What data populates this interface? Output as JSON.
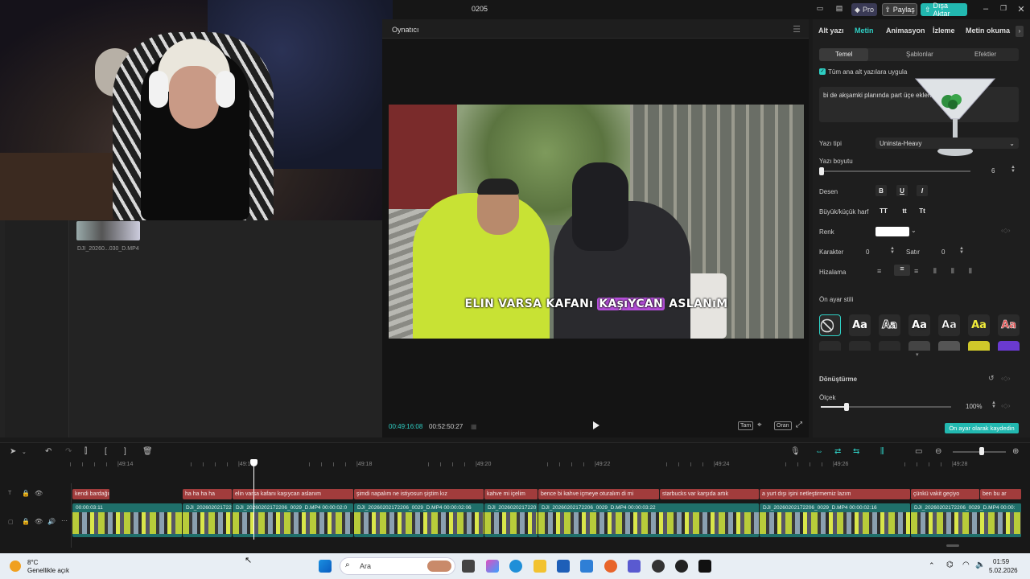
{
  "window": {
    "title": "0205",
    "pro_label": "Pro",
    "share_label": "Paylaş",
    "export_label": "Dışa Aktar"
  },
  "media": {
    "thumb_label": "DJI_20260...030_D.MP4"
  },
  "player": {
    "title": "Oynatıcı",
    "current_time": "00:49:16:08",
    "total_time": "00:52:50:27",
    "btn_full": "Tam",
    "btn_ratio": "Oran",
    "subtitle_pre": "ELIN VARSA KAFANı",
    "subtitle_hl": "KAşıYCAN",
    "subtitle_post": "ASLANıM"
  },
  "right_panel": {
    "tabs": [
      "Alt yazı",
      "Metin",
      "Animasyon",
      "İzleme",
      "Metin okuma"
    ],
    "active_tab": "Metin",
    "subtabs": [
      "Temel",
      "Şablonlar",
      "Efektler"
    ],
    "apply_all_label": "Tüm ana alt yazılara uygula",
    "text_value": "bi de akşamki planında part üçe ekleriz",
    "font_label": "Yazı tipi",
    "font_value": "Uninsta-Heavy",
    "size_label": "Yazı boyutu",
    "size_value": "6",
    "pattern_label": "Desen",
    "case_label": "Büyük/küçük harf",
    "case_options": [
      "TT",
      "tt",
      "Tt"
    ],
    "color_label": "Renk",
    "char_label": "Karakter",
    "char_value": "0",
    "line_label": "Satır",
    "line_value": "0",
    "align_label": "Hizalama",
    "preset_label": "Ön ayar stili",
    "preset_sample": "Aa",
    "transform_label": "Dönüştürme",
    "scale_label": "Ölçek",
    "scale_value": "100%",
    "scale_fraction": 0.2,
    "save_preset_label": "Ön ayar olarak kaydedin",
    "accent": "#2fcfc4"
  },
  "timeline": {
    "ruler": [
      "|49:14",
      "|49:16",
      "|49:18",
      "|49:20",
      "|49:22",
      "|49:24",
      "|49:26",
      "|49:28"
    ],
    "subtitle_clips": [
      "kendi bardağını fondötenleyip yap",
      "ha ha ha ha",
      "elin varsa kafanı kaşıycan aslanım",
      "şimdi napalım ne istiyosun şiştim kız",
      "kahve mi içelim",
      "bence bi kahve içmeye oturalım di mi",
      "starbucks var karşıda artık",
      "a yurt dışı işini netleştirmemiz lazım",
      "çünkü vakit geçiyo",
      "ben bu ar"
    ],
    "video_clips": [
      "00:00:03:11",
      "DJI_2026020217220",
      "DJI_20260202172206_0029_D.MP4  00:00:02:0",
      "DJI_20260202172206_0029_D.MP4  00:00:02:06",
      "DJI_2026020217220",
      "DJI_20260202172206_0029_D.MP4  00:00:03:22",
      "DJI_20260202172206_0029_D.MP4  00:00:02:16",
      "DJI_20260202172206_0029_D.MP4  00:00:"
    ]
  },
  "taskbar": {
    "temp": "8°C",
    "weather": "Genellikle açık",
    "search": "Ara",
    "time": "01:59",
    "date": "5.02.2026"
  }
}
